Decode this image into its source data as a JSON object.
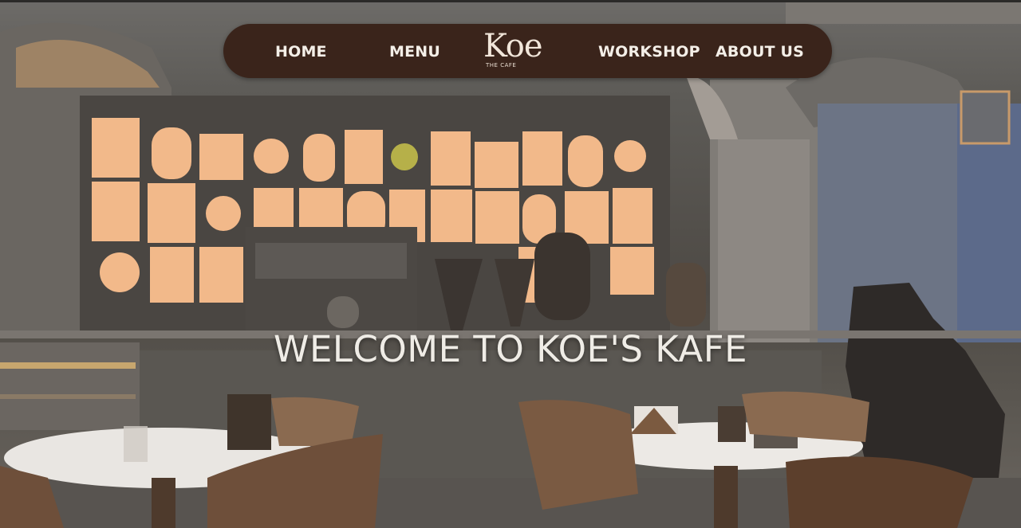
{
  "nav": {
    "home": "HOME",
    "menu": "MENU",
    "logo_text": "Koe",
    "logo_subtext": "THE CAFE",
    "workshop": "WORKSHOP",
    "about": "ABOUT US"
  },
  "hero": {
    "heading": "WELCOME TO KOE'S KAFE"
  },
  "colors": {
    "navbar_bg": "#3a241b",
    "nav_text": "#f4efe8",
    "heading_text": "#efece6"
  }
}
